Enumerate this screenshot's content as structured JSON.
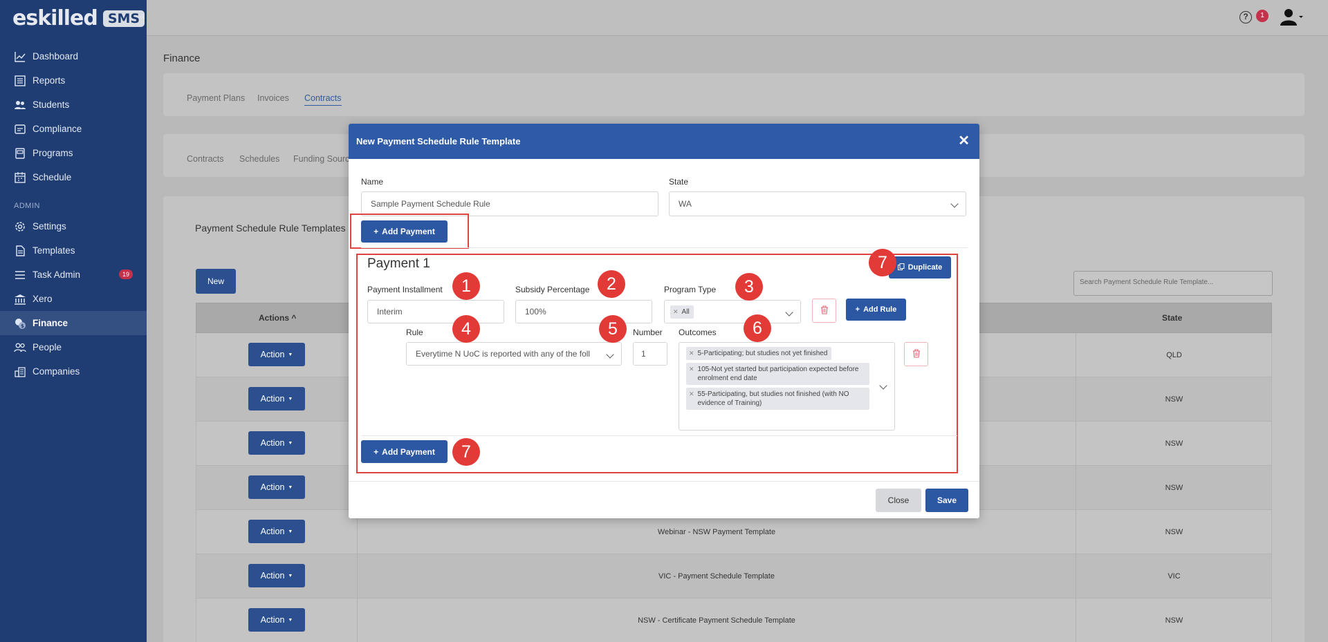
{
  "app": {
    "logo_text": "eskilled",
    "logo_badge": "SMS",
    "help_badge_count": "1"
  },
  "sidebar": {
    "items": [
      {
        "label": "Dashboard",
        "icon": "chart-line-icon"
      },
      {
        "label": "Reports",
        "icon": "reports-icon"
      },
      {
        "label": "Students",
        "icon": "users-icon"
      },
      {
        "label": "Compliance",
        "icon": "compliance-icon"
      },
      {
        "label": "Programs",
        "icon": "programs-icon"
      },
      {
        "label": "Schedule",
        "icon": "calendar-icon"
      }
    ],
    "admin_heading": "ADMIN",
    "admin_items": [
      {
        "label": "Settings",
        "icon": "gear-icon"
      },
      {
        "label": "Templates",
        "icon": "templates-icon"
      },
      {
        "label": "Task Admin",
        "icon": "list-icon",
        "badge": "19"
      },
      {
        "label": "Xero",
        "icon": "bank-icon"
      },
      {
        "label": "Finance",
        "icon": "finance-icon",
        "active": true
      },
      {
        "label": "People",
        "icon": "people-icon"
      },
      {
        "label": "Companies",
        "icon": "companies-icon"
      }
    ]
  },
  "page": {
    "title": "Finance",
    "tabs": [
      "Payment Plans",
      "Invoices",
      "Contracts"
    ],
    "active_tab": "Contracts",
    "subtabs": [
      "Contracts",
      "Schedules",
      "Funding Source"
    ],
    "card_title": "Payment Schedule Rule Templates",
    "new_button": "New",
    "search_placeholder": "Search Payment Schedule Rule Template...",
    "table": {
      "col_actions": "Actions",
      "col_state": "State",
      "action_label": "Action",
      "rows": [
        {
          "name": "",
          "state": "QLD"
        },
        {
          "name": "",
          "state": "NSW"
        },
        {
          "name": "",
          "state": "NSW"
        },
        {
          "name": "",
          "state": "NSW"
        },
        {
          "name": "Webinar - NSW Payment Template",
          "state": "NSW"
        },
        {
          "name": "VIC - Payment Schedule Template",
          "state": "VIC"
        },
        {
          "name": "NSW - Certificate Payment Schedule Template",
          "state": "NSW"
        }
      ]
    }
  },
  "modal": {
    "title": "New Payment Schedule Rule Template",
    "name_label": "Name",
    "name_value": "Sample Payment Schedule Rule",
    "state_label": "State",
    "state_value": "WA",
    "add_payment_label": "Add Payment",
    "payment": {
      "heading": "Payment 1",
      "duplicate_label": "Duplicate",
      "installment_label": "Payment Installment",
      "installment_value": "Interim",
      "subsidy_label": "Subsidy Percentage",
      "subsidy_value": "100%",
      "program_type_label": "Program Type",
      "program_type_tag": "All",
      "add_rule_label": "Add Rule",
      "rule_label": "Rule",
      "rule_value": "Everytime N UoC is reported with any of the foll",
      "number_label": "Number",
      "number_value": "1",
      "outcomes_label": "Outcomes",
      "outcomes": [
        "5-Participating; but studies not yet finished",
        "105-Not yet started but participation expected before enrolment end date",
        "55-Participating, but studies not finished (with NO evidence of Training)"
      ]
    },
    "close_label": "Close",
    "save_label": "Save"
  },
  "markers": [
    "1",
    "2",
    "3",
    "4",
    "5",
    "6",
    "7",
    "7"
  ]
}
